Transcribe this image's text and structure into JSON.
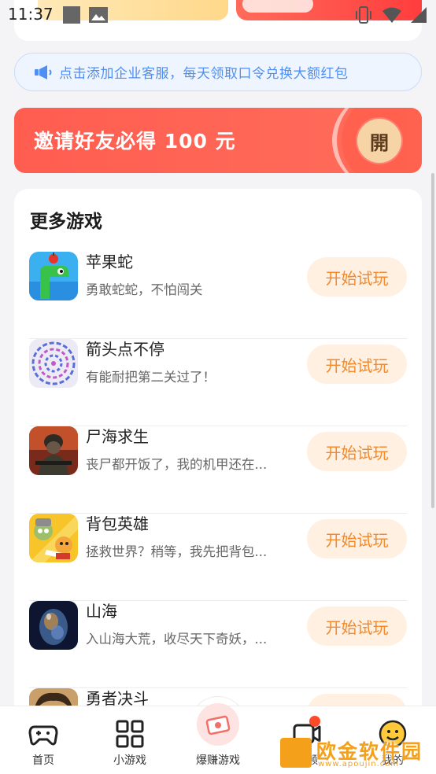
{
  "status_bar": {
    "time": "11:37"
  },
  "notice": {
    "text": "点击添加企业客服，每天领取口令兑换大额红包"
  },
  "invite": {
    "text": "邀请好友必得 100 元",
    "open_label": "開"
  },
  "games": {
    "title": "更多游戏",
    "play_label": "开始试玩",
    "items": [
      {
        "name": "苹果蛇",
        "desc": "勇敢蛇蛇，不怕闯关",
        "icon": "apple-snake-icon"
      },
      {
        "name": "箭头点不停",
        "desc": "有能耐把第二关过了！",
        "icon": "maze-icon"
      },
      {
        "name": "尸海求生",
        "desc": "丧尸都开饭了，我的机甲还在...",
        "icon": "soldier-icon"
      },
      {
        "name": "背包英雄",
        "desc": "拯救世界？稍等，我先把背包...",
        "icon": "backpack-hero-icon"
      },
      {
        "name": "山海",
        "desc": "入山海大荒，收尽天下奇妖，...",
        "icon": "egg-icon"
      },
      {
        "name": "勇者决斗",
        "desc": "",
        "icon": "warrior-icon"
      }
    ]
  },
  "bottom_nav": {
    "items": [
      {
        "label": "首页",
        "icon": "gamepad-icon"
      },
      {
        "label": "小游戏",
        "icon": "grid-icon"
      },
      {
        "label": "爆赚游戏",
        "icon": "money-icon"
      },
      {
        "label": "视频",
        "icon": "video-icon"
      },
      {
        "label": "我的",
        "icon": "smiley-icon"
      }
    ]
  },
  "watermark": {
    "text": "欧金软件园",
    "url": "www.apoujin.com"
  },
  "colors": {
    "accent": "#f28a2d",
    "banner": "#ff5d50",
    "notice": "#4f8ef2"
  }
}
